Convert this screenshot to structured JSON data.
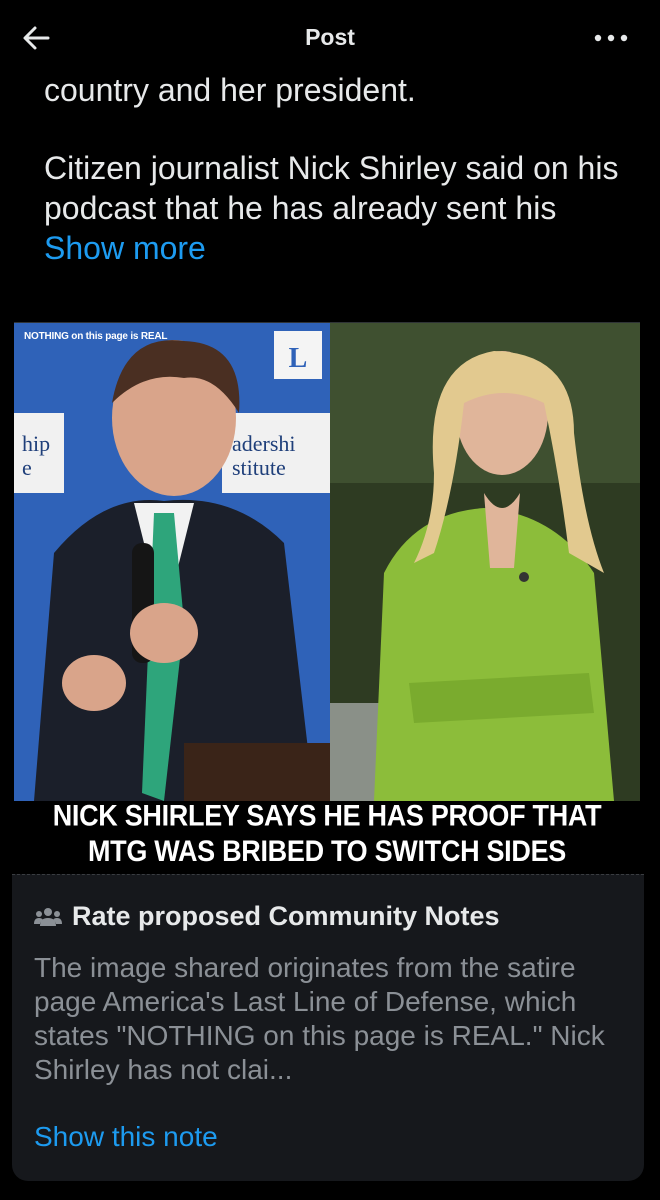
{
  "header": {
    "title": "Post"
  },
  "post": {
    "line_partial": "country and her president.",
    "paragraph2": "Citizen journalist Nick Shirley said on his podcast that he has already sent his",
    "show_more": "Show more"
  },
  "media": {
    "watermark": "NOTHING on this page is REAL",
    "caption_line1": "NICK SHIRLEY SAYS HE HAS PROOF THAT",
    "caption_line2": "MTG WAS BRIBED TO SWITCH SIDES",
    "backdrop_left_text": [
      "hip",
      "e"
    ],
    "backdrop_right_text": [
      "adershi",
      "stitute"
    ],
    "backdrop_logo": "L"
  },
  "community_note": {
    "title": "Rate proposed Community Notes",
    "body": "The image shared originates from the satire page America's Last Line of Defense, which states \"NOTHING on this page is REAL.\" Nick Shirley has not clai...",
    "link": "Show this note"
  },
  "colors": {
    "background": "#000000",
    "text": "#e7e9ea",
    "accent": "#1d9bf0",
    "muted": "#8b9096",
    "card": "#16181c"
  },
  "icons": {
    "back": "arrow-left-icon",
    "more": "more-dots-icon",
    "notes": "people-icon"
  }
}
